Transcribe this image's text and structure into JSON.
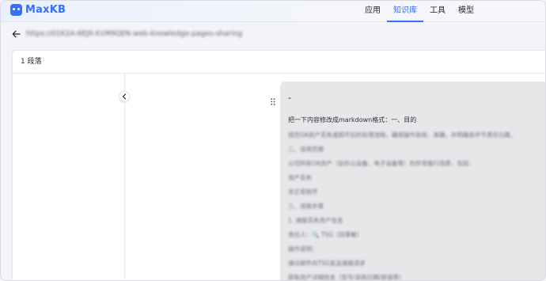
{
  "app": {
    "name": "MaxKB"
  },
  "nav": {
    "items": [
      {
        "label": "应用",
        "active": false
      },
      {
        "label": "知识库",
        "active": true
      },
      {
        "label": "工具",
        "active": false
      },
      {
        "label": "模型",
        "active": false
      }
    ]
  },
  "breadcrumb": {
    "title": "https://01K2A-6EJ9-X1M9QEN-web-knowledge-pages-sharing"
  },
  "card": {
    "header": "1 段落"
  },
  "paragraph": {
    "dash": "-",
    "lines": [
      "把一下内容修改成markdown格式：一、目的",
      "规范OA资产丢失或损坏后的处理流程，确保操作高效、准确，并明确各环节责任归属。",
      "二、适用范围",
      "公司所有OA资产（如办公设备、电子设备等）的异常报行场景，包括：",
      "资产丢失",
      "非正常损坏",
      "三、流程步骤",
      "1. 通报丢失资产信息",
      "责任人：🔍 TSG（同事敏）",
      "操作说明：",
      "通过邮件向TSG发送通报请求",
      "获取资产详细信息（型号/采购日期/原值等）"
    ]
  },
  "colors": {
    "accent": "#3370ff"
  }
}
